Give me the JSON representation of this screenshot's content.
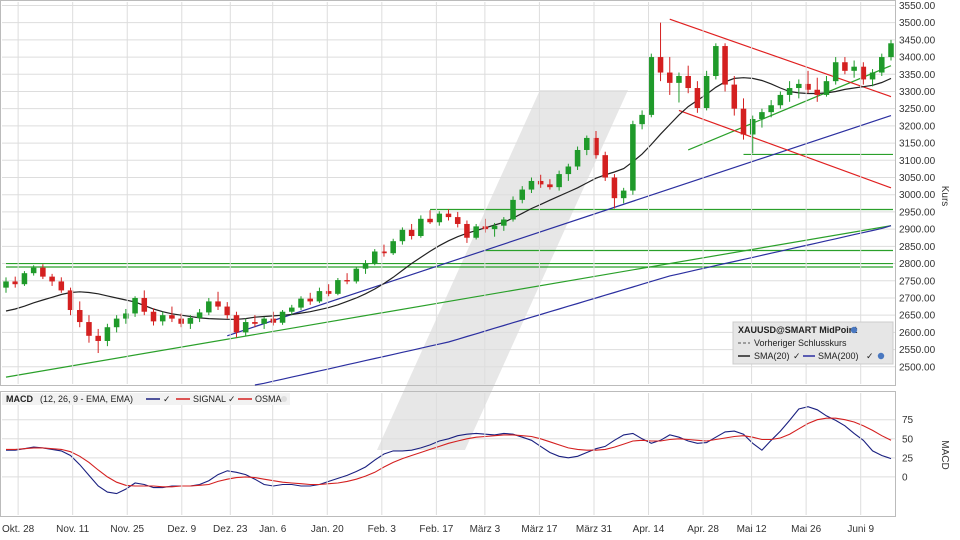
{
  "chart_data": [
    {
      "type": "candlestick",
      "name": "price-panel",
      "ylabel": "Kurs",
      "ylim": [
        2450,
        3560
      ],
      "yticks": [
        2500,
        2550,
        2600,
        2650,
        2700,
        2750,
        2800,
        2850,
        2900,
        2950,
        3000,
        3050,
        3100,
        3150,
        3200,
        3250,
        3300,
        3350,
        3400,
        3450,
        3500,
        3550
      ],
      "ytick_labels": [
        "2500.00",
        "2550.00",
        "2600.00",
        "2650.00",
        "2700.00",
        "2750.00",
        "2800.00",
        "2850.00",
        "2900.00",
        "2950.00",
        "3000.00",
        "3050.00",
        "3100.00",
        "3150.00",
        "3200.00",
        "3250.00",
        "3300.00",
        "3350.00",
        "3400.00",
        "3450.00",
        "3500.00",
        "3550.00"
      ],
      "grid": true,
      "candles": [
        [
          2730,
          2760,
          2715,
          2748
        ],
        [
          2748,
          2762,
          2730,
          2740
        ],
        [
          2740,
          2778,
          2735,
          2772
        ],
        [
          2772,
          2795,
          2765,
          2788
        ],
        [
          2788,
          2798,
          2755,
          2762
        ],
        [
          2762,
          2770,
          2735,
          2748
        ],
        [
          2748,
          2760,
          2715,
          2722
        ],
        [
          2722,
          2730,
          2650,
          2665
        ],
        [
          2665,
          2690,
          2615,
          2630
        ],
        [
          2630,
          2650,
          2570,
          2590
        ],
        [
          2590,
          2610,
          2540,
          2575
        ],
        [
          2575,
          2625,
          2560,
          2615
        ],
        [
          2615,
          2650,
          2600,
          2640
        ],
        [
          2640,
          2668,
          2625,
          2655
        ],
        [
          2655,
          2705,
          2645,
          2700
        ],
        [
          2700,
          2722,
          2650,
          2660
        ],
        [
          2660,
          2670,
          2620,
          2632
        ],
        [
          2632,
          2660,
          2620,
          2650
        ],
        [
          2650,
          2675,
          2630,
          2640
        ],
        [
          2640,
          2655,
          2615,
          2625
        ],
        [
          2625,
          2650,
          2610,
          2642
        ],
        [
          2642,
          2668,
          2630,
          2658
        ],
        [
          2658,
          2700,
          2650,
          2690
        ],
        [
          2690,
          2718,
          2665,
          2675
        ],
        [
          2675,
          2688,
          2640,
          2650
        ],
        [
          2650,
          2660,
          2585,
          2600
        ],
        [
          2600,
          2640,
          2590,
          2630
        ],
        [
          2630,
          2650,
          2615,
          2625
        ],
        [
          2625,
          2645,
          2610,
          2640
        ],
        [
          2640,
          2660,
          2620,
          2628
        ],
        [
          2628,
          2665,
          2622,
          2660
        ],
        [
          2660,
          2680,
          2650,
          2672
        ],
        [
          2672,
          2705,
          2665,
          2698
        ],
        [
          2698,
          2715,
          2680,
          2690
        ],
        [
          2690,
          2730,
          2685,
          2720
        ],
        [
          2720,
          2740,
          2705,
          2712
        ],
        [
          2712,
          2758,
          2708,
          2752
        ],
        [
          2752,
          2772,
          2740,
          2748
        ],
        [
          2748,
          2790,
          2742,
          2785
        ],
        [
          2785,
          2810,
          2770,
          2800
        ],
        [
          2800,
          2842,
          2795,
          2835
        ],
        [
          2835,
          2855,
          2820,
          2830
        ],
        [
          2830,
          2872,
          2825,
          2865
        ],
        [
          2865,
          2905,
          2855,
          2898
        ],
        [
          2898,
          2915,
          2870,
          2880
        ],
        [
          2880,
          2940,
          2875,
          2930
        ],
        [
          2930,
          2955,
          2915,
          2920
        ],
        [
          2920,
          2952,
          2910,
          2945
        ],
        [
          2945,
          2958,
          2925,
          2935
        ],
        [
          2935,
          2950,
          2905,
          2915
        ],
        [
          2915,
          2925,
          2860,
          2875
        ],
        [
          2875,
          2915,
          2870,
          2908
        ],
        [
          2908,
          2930,
          2890,
          2900
        ],
        [
          2900,
          2918,
          2878,
          2910
        ],
        [
          2910,
          2935,
          2895,
          2928
        ],
        [
          2928,
          2995,
          2922,
          2985
        ],
        [
          2985,
          3025,
          2975,
          3015
        ],
        [
          3015,
          3050,
          3005,
          3040
        ],
        [
          3040,
          3058,
          3020,
          3030
        ],
        [
          3030,
          3045,
          3015,
          3022
        ],
        [
          3022,
          3070,
          3012,
          3060
        ],
        [
          3060,
          3090,
          3040,
          3082
        ],
        [
          3082,
          3140,
          3072,
          3130
        ],
        [
          3130,
          3172,
          3115,
          3165
        ],
        [
          3165,
          3185,
          3105,
          3115
        ],
        [
          3115,
          3125,
          3040,
          3050
        ],
        [
          3050,
          3060,
          2960,
          2990
        ],
        [
          2990,
          3020,
          2975,
          3012
        ],
        [
          3012,
          3215,
          3000,
          3205
        ],
        [
          3205,
          3245,
          3190,
          3232
        ],
        [
          3232,
          3410,
          3225,
          3400
        ],
        [
          3400,
          3500,
          3330,
          3355
        ],
        [
          3355,
          3400,
          3290,
          3325
        ],
        [
          3325,
          3355,
          3268,
          3345
        ],
        [
          3345,
          3375,
          3295,
          3310
        ],
        [
          3310,
          3330,
          3238,
          3252
        ],
        [
          3252,
          3360,
          3245,
          3345
        ],
        [
          3345,
          3440,
          3335,
          3432
        ],
        [
          3432,
          3440,
          3300,
          3320
        ],
        [
          3320,
          3345,
          3230,
          3250
        ],
        [
          3250,
          3280,
          3160,
          3175
        ],
        [
          3175,
          3230,
          3120,
          3220
        ],
        [
          3220,
          3250,
          3195,
          3240
        ],
        [
          3240,
          3275,
          3225,
          3260
        ],
        [
          3260,
          3300,
          3250,
          3290
        ],
        [
          3290,
          3330,
          3270,
          3310
        ],
        [
          3310,
          3335,
          3280,
          3322
        ],
        [
          3322,
          3360,
          3295,
          3305
        ],
        [
          3305,
          3340,
          3270,
          3290
        ],
        [
          3290,
          3345,
          3285,
          3330
        ],
        [
          3330,
          3400,
          3320,
          3385
        ],
        [
          3385,
          3400,
          3350,
          3360
        ],
        [
          3360,
          3390,
          3340,
          3372
        ],
        [
          3372,
          3385,
          3320,
          3335
        ],
        [
          3335,
          3365,
          3315,
          3355
        ],
        [
          3355,
          3410,
          3345,
          3400
        ],
        [
          3400,
          3450,
          3390,
          3440
        ]
      ],
      "series": [
        {
          "name": "SMA(20)",
          "color": "#222222",
          "values": [
            2662,
            2668,
            2676,
            2686,
            2694,
            2702,
            2710,
            2716,
            2718,
            2716,
            2712,
            2706,
            2700,
            2694,
            2688,
            2678,
            2668,
            2660,
            2654,
            2650,
            2646,
            2642,
            2640,
            2639,
            2638,
            2638,
            2640,
            2644,
            2646,
            2648,
            2650,
            2652,
            2656,
            2660,
            2666,
            2672,
            2680,
            2690,
            2700,
            2712,
            2726,
            2742,
            2760,
            2780,
            2800,
            2818,
            2836,
            2852,
            2866,
            2878,
            2888,
            2896,
            2904,
            2912,
            2920,
            2932,
            2946,
            2960,
            2972,
            2984,
            2996,
            3008,
            3020,
            3034,
            3048,
            3058,
            3066,
            3076,
            3096,
            3118,
            3146,
            3176,
            3204,
            3232,
            3256,
            3274,
            3292,
            3312,
            3328,
            3338,
            3340,
            3338,
            3332,
            3322,
            3310,
            3300,
            3296,
            3294,
            3294,
            3296,
            3300,
            3306,
            3310,
            3314,
            3318,
            3326,
            3338
          ]
        },
        {
          "name": "SMA(200)",
          "color": "#2b2fa0",
          "values": [
            null,
            null,
            null,
            null,
            null,
            null,
            null,
            null,
            null,
            null,
            null,
            null,
            null,
            null,
            null,
            null,
            null,
            null,
            null,
            null,
            null,
            null,
            null,
            null,
            null,
            null,
            null,
            2447,
            2452,
            2458,
            2464,
            2470,
            2476,
            2482,
            2488,
            2494,
            2500,
            2506,
            2512,
            2518,
            2524,
            2530,
            2536,
            2542,
            2548,
            2554,
            2560,
            2566,
            2572,
            2580,
            2588,
            2596,
            2604,
            2612,
            2620,
            2628,
            2636,
            2644,
            2652,
            2660,
            2668,
            2676,
            2684,
            2692,
            2700,
            2708,
            2716,
            2724,
            2732,
            2740,
            2748,
            2756,
            2764,
            2770,
            2776,
            2782,
            2788,
            2794,
            2800,
            2806,
            2812,
            2818,
            2824,
            2830,
            2836,
            2842,
            2848,
            2854,
            2860,
            2866,
            2872,
            2878,
            2884,
            2890,
            2896,
            2902,
            2910
          ]
        }
      ],
      "trendlines": [
        {
          "color": "#2b2fa0",
          "from": [
            24,
            2590
          ],
          "to": [
            96,
            3230
          ]
        },
        {
          "color": "#2aa02a",
          "from": [
            0,
            2470
          ],
          "to": [
            96,
            2910
          ]
        },
        {
          "color": "#2aa02a",
          "from": [
            74,
            3130
          ],
          "to": [
            96,
            3375
          ]
        },
        {
          "color": "#e02020",
          "from": [
            72,
            3510
          ],
          "to": [
            96,
            3285
          ]
        },
        {
          "color": "#e02020",
          "from": [
            73,
            3245
          ],
          "to": [
            96,
            3020
          ]
        }
      ],
      "hlines": [
        {
          "color": "#2aa02a",
          "value": 2800,
          "from": 0
        },
        {
          "color": "#2aa02a",
          "value": 2790,
          "from": 0
        },
        {
          "color": "#2aa02a",
          "value": 2957,
          "from": 46
        },
        {
          "color": "#2aa02a",
          "value": 2838,
          "from": 52
        },
        {
          "color": "#2aa02a",
          "value": 3117,
          "from": 80
        }
      ],
      "legend": {
        "position": "bottom-right",
        "title": "XAUUSD@SMART MidPoint",
        "items": [
          "Vorheriger Schlusskurs",
          "SMA(20)",
          "SMA(200)"
        ]
      }
    },
    {
      "type": "line",
      "name": "macd-panel",
      "title": "MACD",
      "subtitle": "(12, 26, 9 - EMA, EMA)",
      "ylabel": "MACD",
      "ylim": [
        -50,
        110
      ],
      "yticks": [
        0,
        25,
        50,
        75
      ],
      "legend": {
        "position": "top-left",
        "items": [
          "SIGNAL",
          "OSMA"
        ]
      },
      "series": [
        {
          "name": "MACD",
          "color": "#1a2080",
          "values": [
            35,
            35,
            37,
            39,
            38,
            36,
            34,
            28,
            16,
            2,
            -12,
            -20,
            -22,
            -16,
            -8,
            -10,
            -14,
            -14,
            -12,
            -12,
            -12,
            -10,
            -5,
            3,
            8,
            6,
            3,
            -3,
            -10,
            -12,
            -10,
            -10,
            -12,
            -12,
            -10,
            -6,
            -2,
            2,
            7,
            13,
            22,
            30,
            34,
            34,
            35,
            38,
            42,
            47,
            50,
            54,
            56,
            57,
            56,
            55,
            57,
            56,
            52,
            48,
            40,
            32,
            27,
            25,
            27,
            32,
            37,
            40,
            48,
            55,
            57,
            50,
            44,
            48,
            55,
            52,
            47,
            44,
            45,
            52,
            59,
            60,
            56,
            44,
            35,
            48,
            60,
            74,
            89,
            92,
            88,
            80,
            74,
            67,
            57,
            48,
            34,
            28,
            24
          ]
        },
        {
          "name": "SIGNAL",
          "color": "#d42020",
          "values": [
            36,
            36,
            37,
            38,
            38,
            37,
            36,
            33,
            27,
            19,
            9,
            0,
            -7,
            -11,
            -12,
            -12,
            -12,
            -13,
            -13,
            -12,
            -12,
            -11,
            -10,
            -6,
            -3,
            -1,
            0,
            -1,
            -3,
            -5,
            -7,
            -8,
            -9,
            -10,
            -10,
            -9,
            -8,
            -6,
            -3,
            1,
            6,
            13,
            19,
            24,
            28,
            32,
            36,
            40,
            44,
            47,
            50,
            52,
            53,
            54,
            55,
            55,
            54,
            53,
            50,
            46,
            42,
            38,
            36,
            35,
            35,
            36,
            39,
            43,
            47,
            48,
            47,
            47,
            49,
            50,
            49,
            48,
            47,
            49,
            51,
            53,
            54,
            52,
            49,
            49,
            51,
            56,
            63,
            70,
            75,
            77,
            77,
            75,
            72,
            67,
            61,
            54,
            48
          ]
        },
        {
          "name": "OSMA",
          "color": "#d42020",
          "values": []
        }
      ]
    }
  ],
  "x_axis": {
    "tick_labels": [
      "Okt. 28",
      "Nov. 11",
      "Nov. 25",
      "Dez. 9",
      "Dez. 23",
      "Jan. 6",
      "Jan. 20",
      "Feb. 3",
      "Feb. 17",
      "März 3",
      "März 17",
      "März 31",
      "Apr. 14",
      "Apr. 28",
      "Mai 12",
      "Mai 26",
      "Juni 9"
    ],
    "tick_index": [
      2,
      11,
      20,
      29,
      37,
      44,
      53,
      62,
      71,
      79,
      88,
      97,
      106,
      115,
      123,
      132,
      141
    ]
  },
  "colors": {
    "up": "#1f9a2a",
    "down": "#d42020",
    "grid": "#dddddd",
    "watermark": "#e5e5e5"
  }
}
